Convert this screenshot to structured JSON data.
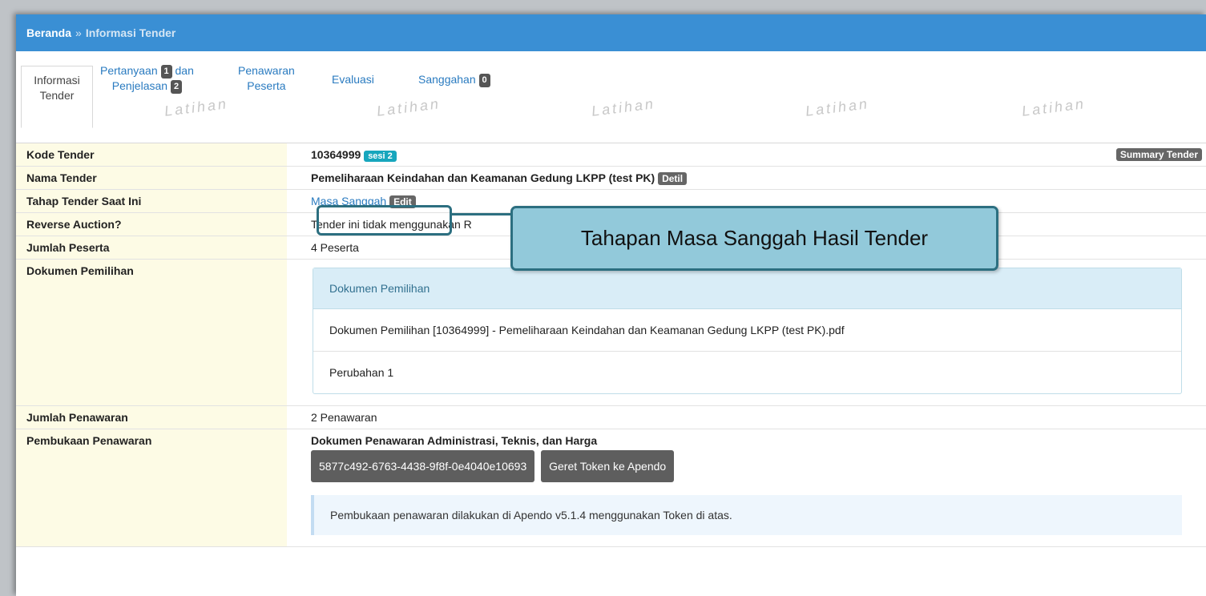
{
  "breadcrumb": {
    "home": "Beranda",
    "separator": "»",
    "current": "Informasi Tender"
  },
  "tabs": [
    {
      "line1": "Informasi",
      "line2": "Tender"
    },
    {
      "line1": "Pertanyaan",
      "badge1": "1",
      "mid": "dan",
      "line2": "Penjelasan",
      "badge2": "2"
    },
    {
      "line1": "Penawaran",
      "line2": "Peserta"
    },
    {
      "line1": "Evaluasi"
    },
    {
      "line1": "Sanggahan",
      "badge1": "0"
    }
  ],
  "watermark": "Latihan",
  "rows": {
    "kode": {
      "label": "Kode Tender",
      "value": "10364999",
      "sesi": "sesi 2",
      "summary": "Summary Tender"
    },
    "nama": {
      "label": "Nama Tender",
      "value": "Pemeliharaan Keindahan dan Keamanan Gedung LKPP (test PK)",
      "detil": "Detil"
    },
    "tahap": {
      "label": "Tahap Tender Saat Ini",
      "value": "Masa Sanggah",
      "edit": "Edit"
    },
    "reverse": {
      "label": "Reverse Auction?",
      "value": "Tender ini tidak menggunakan R"
    },
    "peserta": {
      "label": "Jumlah Peserta",
      "value": "4 Peserta"
    },
    "dokumen": {
      "label": "Dokumen Pemilihan",
      "panel_title": "Dokumen Pemilihan",
      "file": "Dokumen Pemilihan [10364999] - Pemeliharaan Keindahan dan Keamanan Gedung LKPP (test PK).pdf",
      "perubahan": "Perubahan 1"
    },
    "penawaran": {
      "label": "Jumlah Penawaran",
      "value": "2 Penawaran"
    },
    "pembukaan": {
      "label": "Pembukaan Penawaran",
      "heading": "Dokumen Penawaran Administrasi, Teknis, dan Harga",
      "token": "5877c492-6763-4438-9f8f-0e4040e10693",
      "button": "Geret Token ke Apendo",
      "note": "Pembukaan penawaran dilakukan di Apendo v5.1.4 menggunakan Token di atas."
    }
  },
  "callout": {
    "text": "Tahapan Masa Sanggah Hasil Tender"
  },
  "colors": {
    "header": "#3a8fd4",
    "label_bg": "#fdfbe5",
    "callout_bg": "#92c9da",
    "callout_border": "#2c6f80"
  }
}
